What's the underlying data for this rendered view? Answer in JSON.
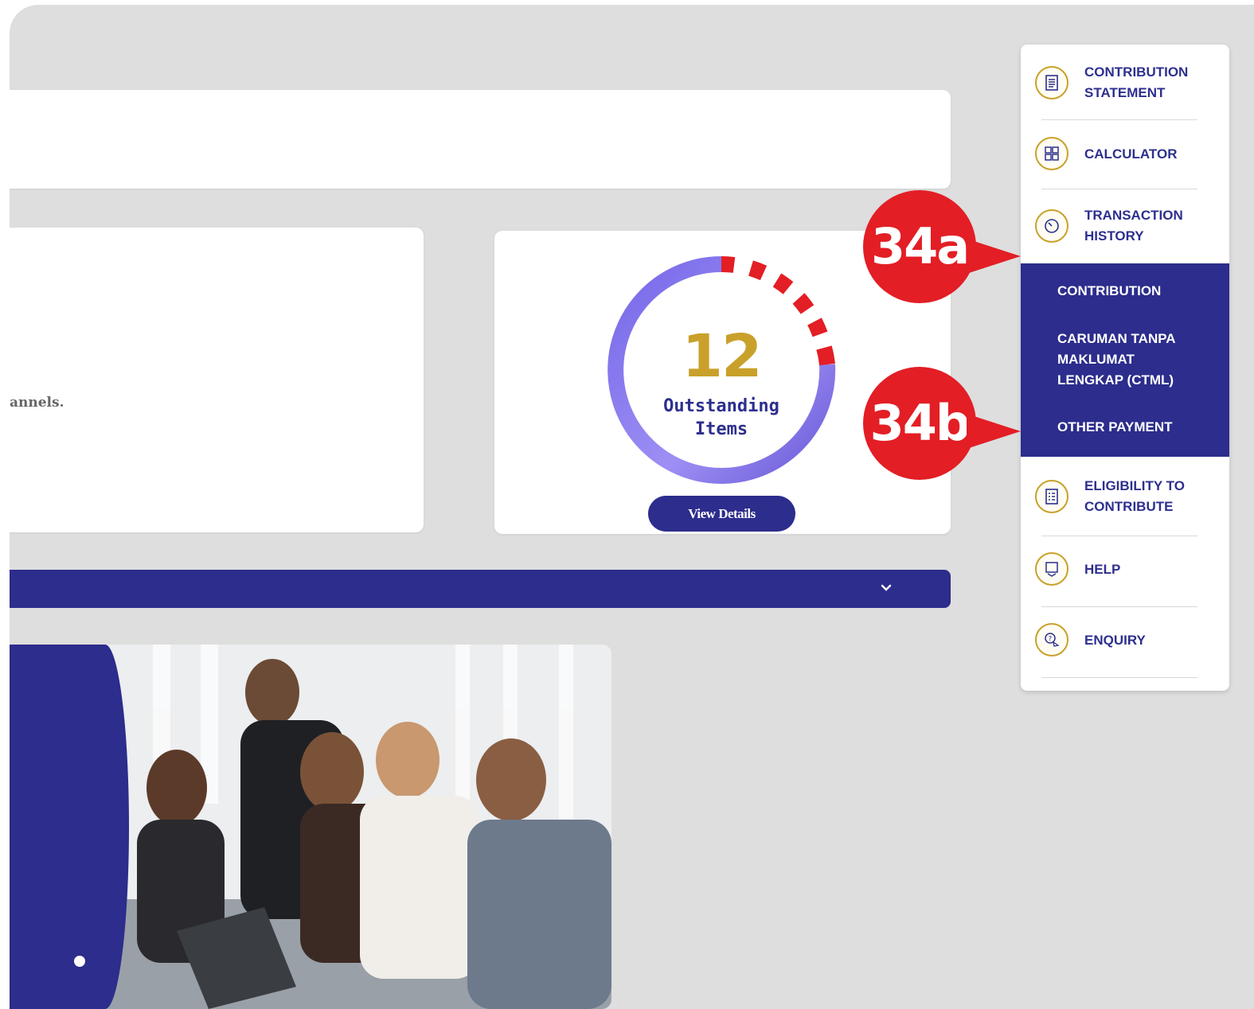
{
  "left_card": {
    "text": "annels."
  },
  "outstanding": {
    "count": "12",
    "label_line1": "Outstanding",
    "label_line2": "Items",
    "button": "View Details",
    "completed_fraction": 0.85
  },
  "sidebar": {
    "items": [
      {
        "label_line1": "CONTRIBUTION",
        "label_line2": "STATEMENT",
        "icon": "document-icon"
      },
      {
        "label_line1": "CALCULATOR",
        "label_line2": "",
        "icon": "calculator-icon"
      },
      {
        "label_line1": "TRANSACTION",
        "label_line2": "HISTORY",
        "icon": "clock-icon"
      },
      {
        "label_line1": "ELIGIBILITY TO",
        "label_line2": "CONTRIBUTE",
        "icon": "checklist-icon"
      },
      {
        "label_line1": "HELP",
        "label_line2": "",
        "icon": "help-icon"
      },
      {
        "label_line1": "ENQUIRY",
        "label_line2": "",
        "icon": "enquiry-icon"
      }
    ],
    "submenu": [
      {
        "label": "CONTRIBUTION"
      },
      {
        "label_line1": "CARUMAN TANPA",
        "label_line2": "MAKLUMAT",
        "label_line3": "LENGKAP (CTML)"
      },
      {
        "label": "OTHER PAYMENT"
      }
    ]
  },
  "callouts": {
    "a": "34a",
    "b": "34b"
  },
  "colors": {
    "primary": "#2c2d8c",
    "accent_gold": "#c9a12a",
    "callout_red": "#e31e25",
    "background": "#dedede"
  }
}
